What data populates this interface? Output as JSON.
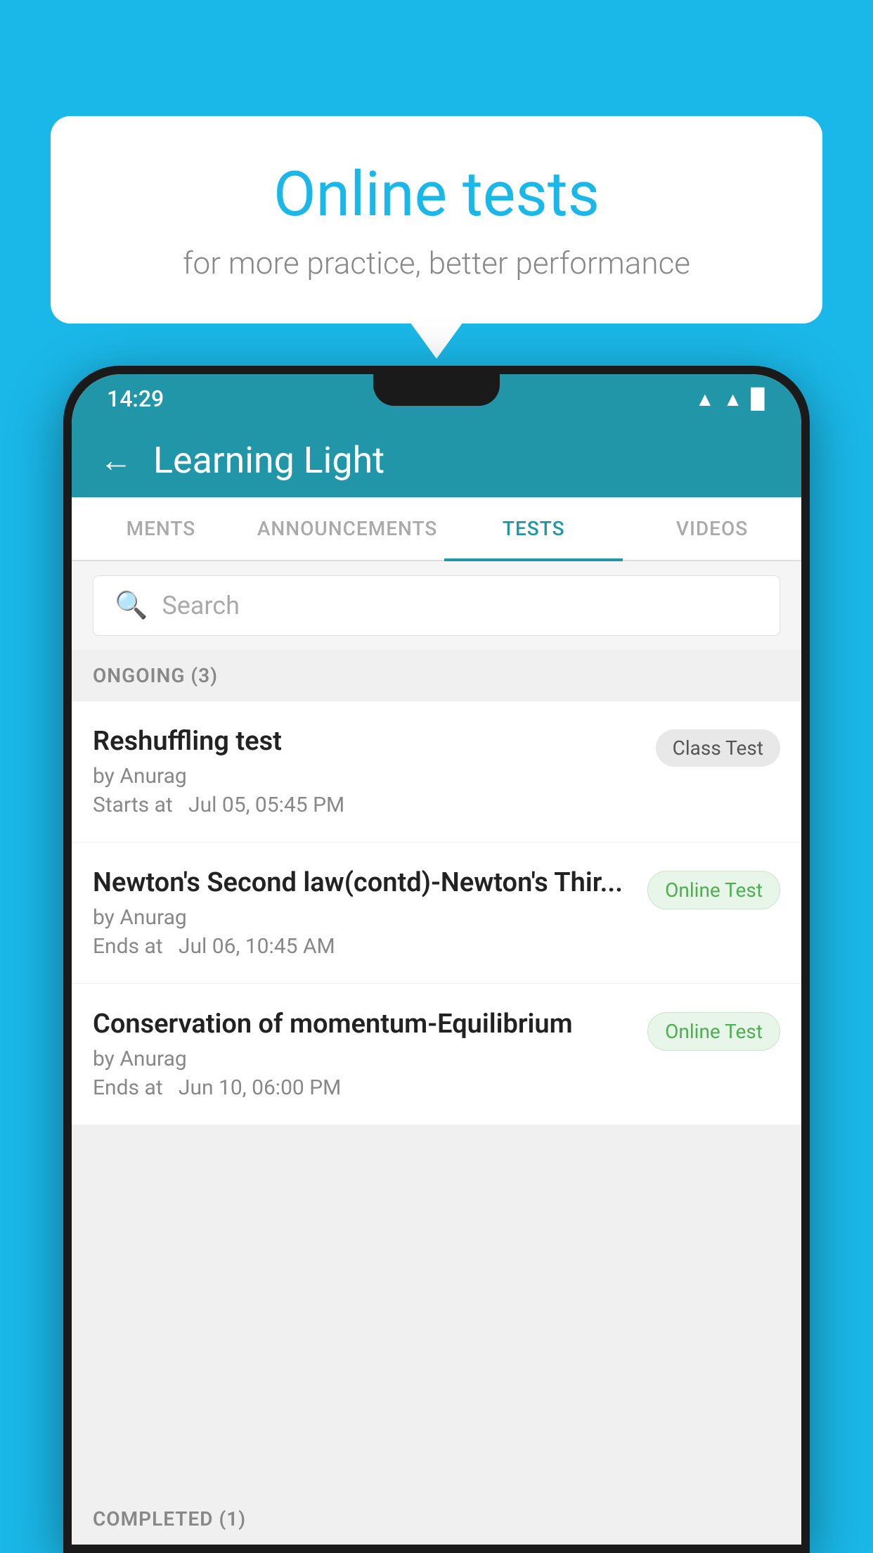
{
  "bubble": {
    "title": "Online tests",
    "subtitle": "for more practice, better performance"
  },
  "status_bar": {
    "time": "14:29",
    "icons": [
      "wifi",
      "signal",
      "battery"
    ]
  },
  "app_header": {
    "title": "Learning Light",
    "back_label": "←"
  },
  "tabs": [
    {
      "label": "MENTS",
      "active": false
    },
    {
      "label": "ANNOUNCEMENTS",
      "active": false
    },
    {
      "label": "TESTS",
      "active": true
    },
    {
      "label": "VIDEOS",
      "active": false
    }
  ],
  "search": {
    "placeholder": "Search"
  },
  "ongoing_section": {
    "label": "ONGOING (3)"
  },
  "tests": [
    {
      "name": "Reshuffling test",
      "author": "by Anurag",
      "time_label": "Starts at",
      "time": "Jul 05, 05:45 PM",
      "badge": "Class Test",
      "badge_type": "class"
    },
    {
      "name": "Newton's Second law(contd)-Newton's Thir...",
      "author": "by Anurag",
      "time_label": "Ends at",
      "time": "Jul 06, 10:45 AM",
      "badge": "Online Test",
      "badge_type": "online"
    },
    {
      "name": "Conservation of momentum-Equilibrium",
      "author": "by Anurag",
      "time_label": "Ends at",
      "time": "Jun 10, 06:00 PM",
      "badge": "Online Test",
      "badge_type": "online"
    }
  ],
  "completed_section": {
    "label": "COMPLETED (1)"
  }
}
